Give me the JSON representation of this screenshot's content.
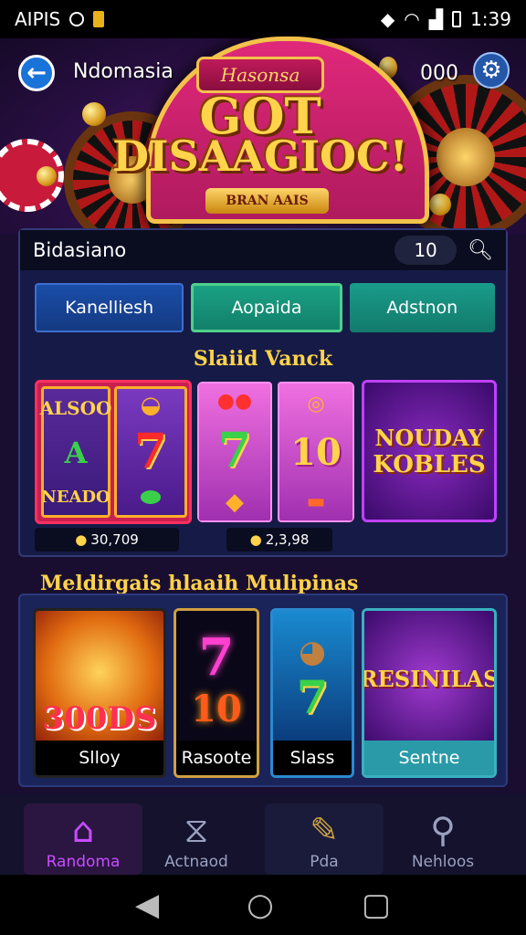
{
  "status_bar": {
    "left_text": "AIPIS",
    "time": "1:39"
  },
  "header": {
    "title": "Ndomasia",
    "coin_count": "000"
  },
  "banner": {
    "tab_text": "Hasonsa",
    "line1": "GOT",
    "line2": "DISAAGIOC!",
    "subtitle": "BRAN AAIS"
  },
  "search": {
    "label": "Bidasiano",
    "count": "10"
  },
  "tabs": [
    {
      "label": "Kanelliesh"
    },
    {
      "label": "Aopaida"
    },
    {
      "label": "Adstnon"
    }
  ],
  "slots_section": {
    "title": "Slaiid Vanck",
    "games": [
      {
        "reel1_top": "ALSOO",
        "reel1_mid": "A",
        "reel1_bot": "NEADO",
        "price": "30,709"
      },
      {
        "price": "2,3,98"
      },
      {
        "title_line1": "NOUDAY",
        "title_line2": "KOBLES"
      }
    ]
  },
  "multi_section": {
    "title": "Meldirgais hlaaih Mulipinas",
    "cards": [
      {
        "art_text": "300DS",
        "label": "Slloy"
      },
      {
        "art_text": "10",
        "label": "Rasoote"
      },
      {
        "art_text": "7",
        "label": "Slass"
      },
      {
        "art_text": "RESINILAS",
        "label": "Sentne"
      }
    ]
  },
  "bottom_nav": [
    {
      "label": "Randoma",
      "icon": "home-icon",
      "color": "#c84cff"
    },
    {
      "label": "Actnaod",
      "icon": "ticket-icon",
      "color": "#9aa0c0"
    },
    {
      "label": "Pda",
      "icon": "edit-icon",
      "color": "#c8a040"
    },
    {
      "label": "Nehloos",
      "icon": "search-icon",
      "color": "#9aa0c0"
    }
  ]
}
